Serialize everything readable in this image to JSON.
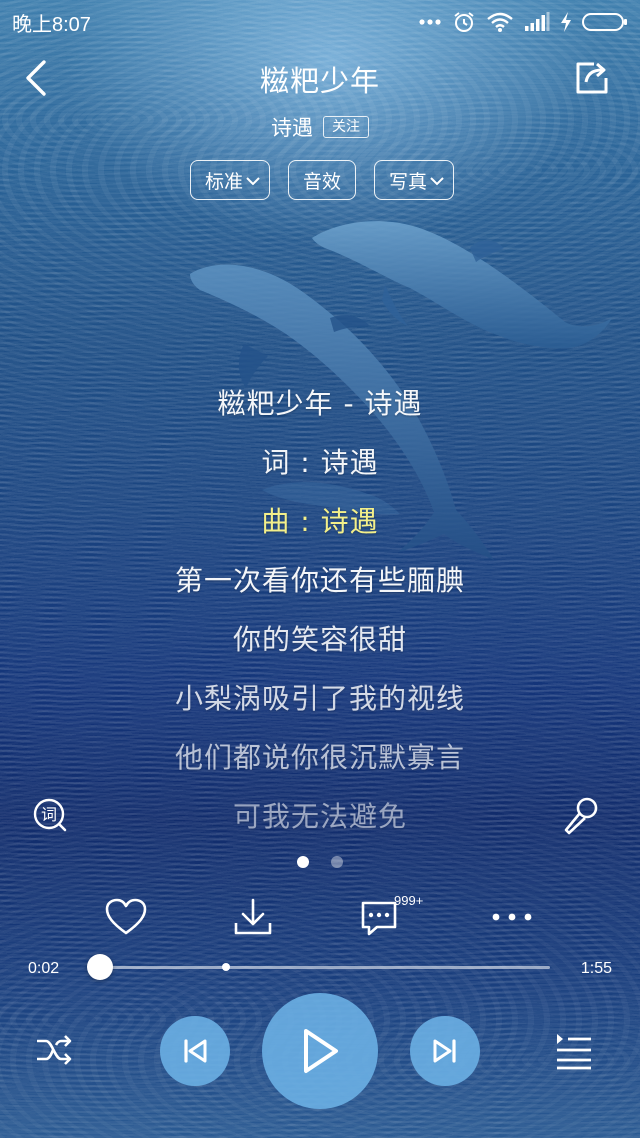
{
  "status_bar": {
    "time": "晚上8:07",
    "icons": [
      "more-dots-icon",
      "alarm-icon",
      "wifi-icon",
      "signal-icon",
      "charging-icon",
      "battery-icon"
    ]
  },
  "header": {
    "back_icon": "back-arrow-icon",
    "title": "糍粑少年",
    "share_icon": "share-icon",
    "artist": "诗遇",
    "follow_label": "关注"
  },
  "modes": {
    "quality": "标准",
    "effect": "音效",
    "visual": "写真"
  },
  "lyrics": [
    "糍粑少年 - 诗遇",
    "词 : 诗遇",
    "曲 : 诗遇",
    "第一次看你还有些腼腆",
    "你的笑容很甜",
    "小梨涡吸引了我的视线",
    "他们都说你很沉默寡言",
    "可我无法避免"
  ],
  "active_lyric_index": 2,
  "side_icons": {
    "lyric": "lyric-icon",
    "karaoke": "microphone-icon"
  },
  "pager": {
    "count": 2,
    "current": 0
  },
  "actions": {
    "like_icon": "heart-icon",
    "download_icon": "download-icon",
    "comment_icon": "comment-icon",
    "comment_badge": "999+",
    "more_icon": "more-icon"
  },
  "progress": {
    "current": "0:02",
    "total": "1:55",
    "played_fraction": 0.0,
    "buffered_fraction": 0.28
  },
  "controls": {
    "mode_icon": "shuffle-icon",
    "prev_icon": "previous-icon",
    "play_icon": "play-icon",
    "next_icon": "next-icon",
    "playlist_icon": "playlist-icon"
  },
  "colors": {
    "active_lyric": "#f3ef8a",
    "control_button": "#6cb2e6"
  }
}
